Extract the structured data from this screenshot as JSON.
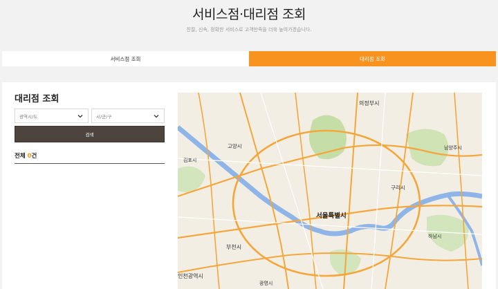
{
  "header": {
    "title": "서비스점·대리점 조회",
    "subtitle": "친절, 신속, 정확한 서비스로 고객만족을 더욱 높여가겠습니다."
  },
  "tabs": [
    {
      "label": "서비스점 조회",
      "active": false
    },
    {
      "label": "대리점 조회",
      "active": true
    }
  ],
  "search": {
    "section_title": "대리점 조회",
    "province_placeholder": "광역시/도",
    "city_placeholder": "시/군/구",
    "button_label": "검색",
    "count_prefix": "전체",
    "count_value": "0",
    "count_suffix": "건"
  },
  "map": {
    "labels": {
      "uijeongbu": "의정부시",
      "namyangju": "남양주시",
      "goyang": "고양시",
      "guri": "구리시",
      "seoul": "서울특별시",
      "bucheon": "부천시",
      "gwangmyeong": "광명시",
      "incheon": "인천광역시",
      "hanam": "하남시",
      "gimpo": "김포시"
    }
  },
  "colors": {
    "accent": "#f7931e",
    "button_dark": "#4d453d",
    "map_land": "#f3eee3",
    "map_green": "#c5dea8",
    "map_water": "#8fb4e8",
    "map_road": "#f4a63a"
  }
}
